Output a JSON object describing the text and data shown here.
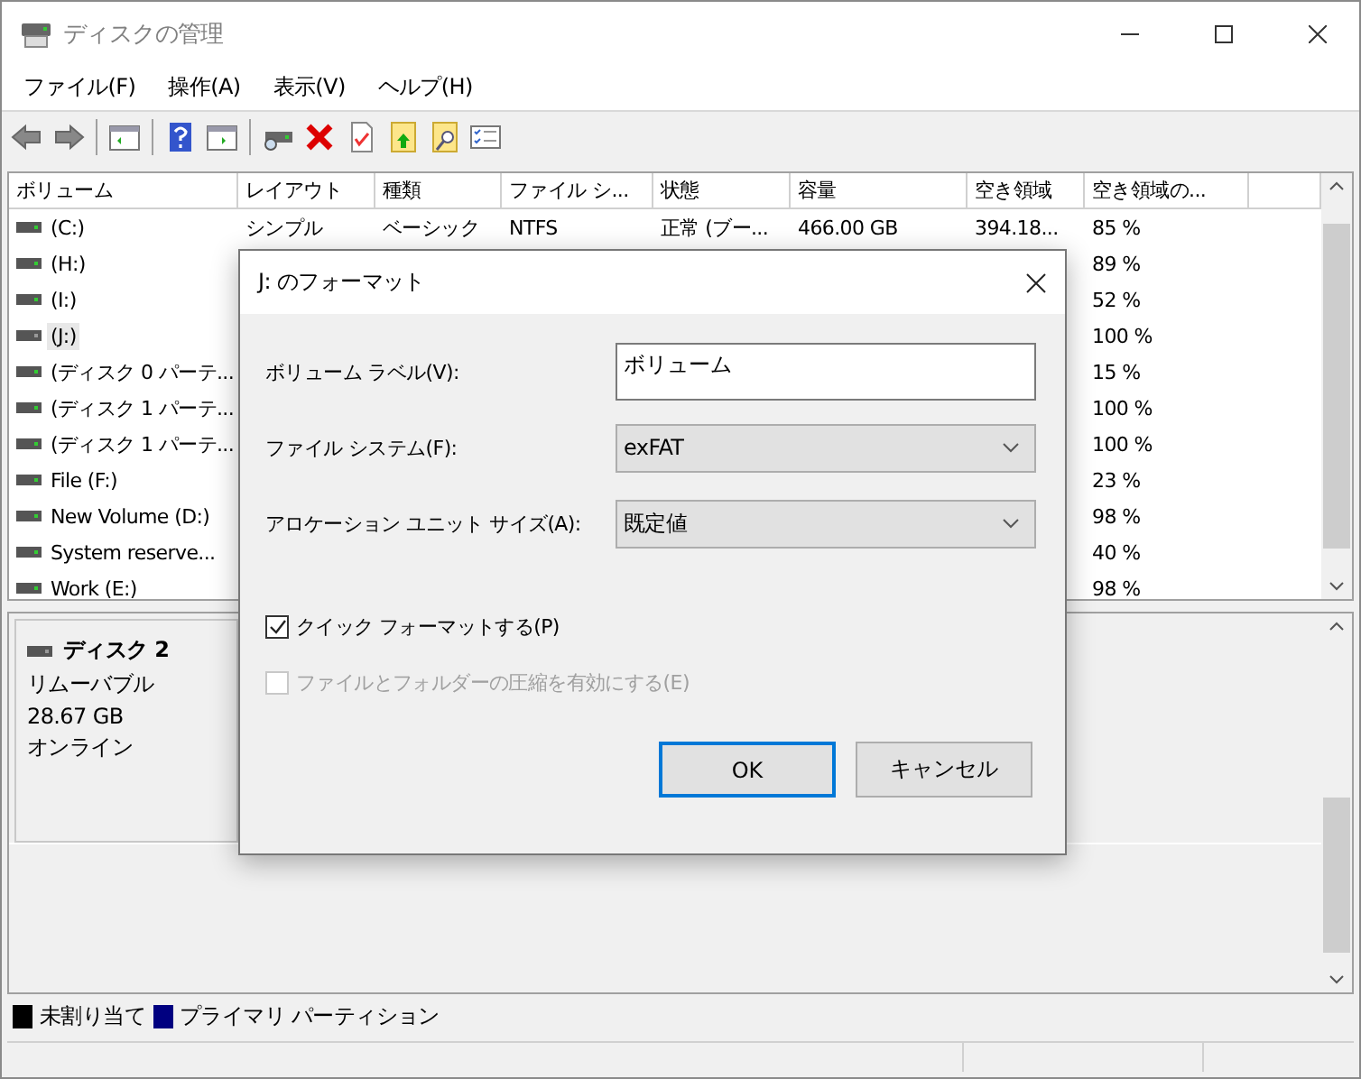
{
  "window": {
    "title": "ディスクの管理"
  },
  "menu": [
    "ファイル(F)",
    "操作(A)",
    "表示(V)",
    "ヘルプ(H)"
  ],
  "table": {
    "columns": [
      "ボリューム",
      "レイアウト",
      "種類",
      "ファイル シ...",
      "状態",
      "容量",
      "空き領域",
      "空き領域の..."
    ],
    "rows": [
      {
        "volume": "(C:)",
        "layout": "シンプル",
        "type": "ベーシック",
        "file_system": "NTFS",
        "status": "正常 (ブー...",
        "capacity": "466.00 GB",
        "free_space": "394.18...",
        "free_percent": "85 %",
        "selected": false
      },
      {
        "volume": "(H:)",
        "free_percent": "89 %",
        "selected": false
      },
      {
        "volume": "(I:)",
        "free_percent": "52 %",
        "selected": false
      },
      {
        "volume": "(J:)",
        "free_percent": "100 %",
        "selected": true
      },
      {
        "volume": "(ディスク 0 パーテ...",
        "free_percent": "15 %",
        "selected": false
      },
      {
        "volume": "(ディスク 1 パーテ...",
        "free_percent": "100 %",
        "selected": false
      },
      {
        "volume": "(ディスク 1 パーテ...",
        "free_percent": "100 %",
        "selected": false
      },
      {
        "volume": "File (F:)",
        "free_percent": "23 %",
        "selected": false
      },
      {
        "volume": "New Volume (D:)",
        "free_percent": "98 %",
        "selected": false
      },
      {
        "volume": "System reserve...",
        "free_percent": "40 %",
        "selected": false
      },
      {
        "volume": "Work (E:)",
        "free_percent": "98 %",
        "selected": false
      }
    ]
  },
  "disk": {
    "name": "ディスク 2",
    "type": "リムーバブル",
    "size": "28.67 GB",
    "status": "オンライン"
  },
  "legend": [
    {
      "label": "未割り当て",
      "color": "#000000"
    },
    {
      "label": "プライマリ パーティション",
      "color": "#000080"
    }
  ],
  "dialog": {
    "title": "J: のフォーマット",
    "fields": [
      {
        "kind": "text",
        "label": "ボリューム ラベル(V):",
        "value": "ボリューム"
      },
      {
        "kind": "select",
        "label": "ファイル システム(F):",
        "value": "exFAT"
      },
      {
        "kind": "select",
        "label": "アロケーション ユニット サイズ(A):",
        "value": "既定値"
      }
    ],
    "checkboxes": [
      {
        "label": "クイック フォーマットする(P)",
        "checked": true,
        "disabled": false
      },
      {
        "label": "ファイルとフォルダーの圧縮を有効にする(E)",
        "checked": false,
        "disabled": true
      }
    ],
    "buttons": [
      {
        "label": "OK",
        "default": true
      },
      {
        "label": "キャンセル",
        "default": false
      }
    ]
  }
}
